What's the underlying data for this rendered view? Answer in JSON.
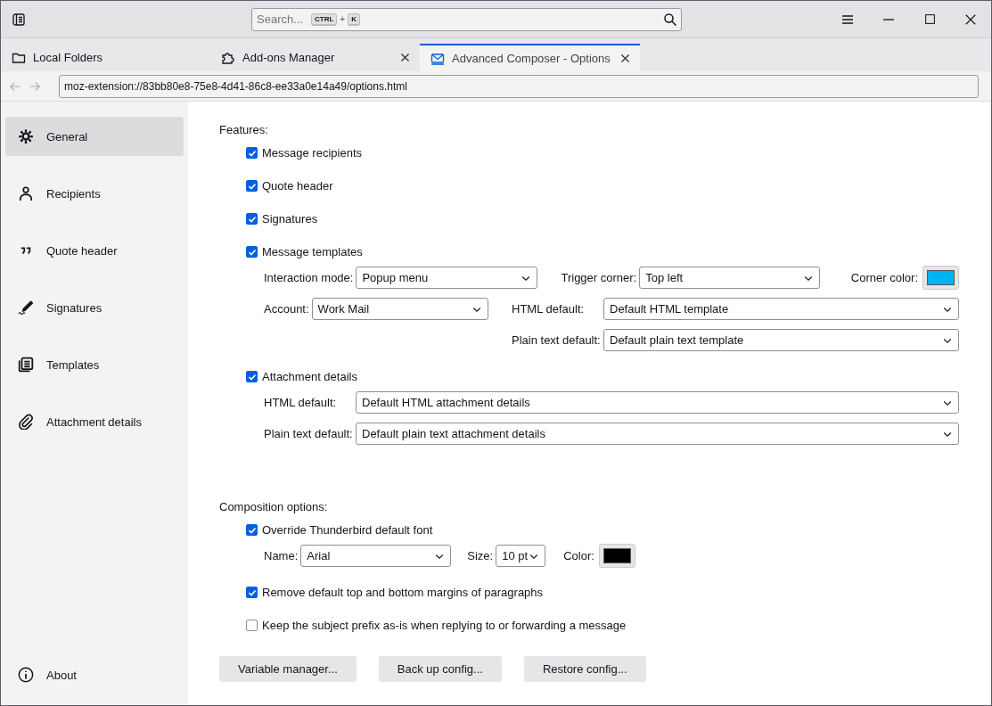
{
  "search": {
    "placeholder": "Search...",
    "shortcut": [
      "CTRL",
      "+",
      "K"
    ]
  },
  "tabs": [
    {
      "kind": "folder",
      "label": "Local Folders",
      "selected": false,
      "closable": false
    },
    {
      "kind": "puzzle",
      "label": "Add-ons Manager",
      "selected": false,
      "closable": true
    },
    {
      "kind": "envelope",
      "label": "Advanced Composer - Options",
      "selected": true,
      "closable": true
    }
  ],
  "url": "moz-extension://83bb80e8-75e8-4d41-86c8-ee33a0e14a49/options.html",
  "sidebar": {
    "items": [
      {
        "kind": "gear",
        "label": "General",
        "selected": true
      },
      {
        "kind": "person",
        "label": "Recipients",
        "selected": false
      },
      {
        "kind": "quote",
        "label": "Quote header",
        "selected": false
      },
      {
        "kind": "pen",
        "label": "Signatures",
        "selected": false
      },
      {
        "kind": "pages",
        "label": "Templates",
        "selected": false
      },
      {
        "kind": "clip",
        "label": "Attachment details",
        "selected": false
      }
    ],
    "about": {
      "label": "About"
    }
  },
  "features": {
    "heading": "Features:",
    "options": [
      {
        "kind": "plain",
        "label": "Message recipients",
        "checked": true
      },
      {
        "kind": "plain",
        "label": "Quote header",
        "checked": true
      },
      {
        "kind": "plain",
        "label": "Signatures",
        "checked": true
      },
      {
        "kind": "templates",
        "label": "Message templates",
        "checked": true,
        "interaction_mode": {
          "label": "Interaction mode:",
          "value": "Popup menu"
        },
        "trigger_corner": {
          "label": "Trigger corner:",
          "value": "Top left"
        },
        "corner_color": {
          "label": "Corner color:",
          "color": "#00b4f0"
        },
        "account": {
          "label": "Account:",
          "value": "Work Mail"
        },
        "html_default": {
          "label": "HTML default:",
          "value": "Default HTML template"
        },
        "plain_default": {
          "label": "Plain text default:",
          "value": "Default plain text template"
        }
      },
      {
        "kind": "attachments",
        "label": "Attachment details",
        "checked": true,
        "html_default": {
          "label": "HTML default:",
          "value": "Default HTML attachment details"
        },
        "plain_default": {
          "label": "Plain text default:",
          "value": "Default plain text attachment details"
        }
      }
    ]
  },
  "composition": {
    "heading": "Composition options:",
    "options": [
      {
        "kind": "font",
        "label": "Override Thunderbird default font",
        "checked": true,
        "name": {
          "label": "Name:",
          "value": "Arial"
        },
        "size": {
          "label": "Size:",
          "value": "10 pt"
        },
        "color": {
          "label": "Color:",
          "color": "#000000"
        }
      },
      {
        "kind": "plain",
        "label": "Remove default top and bottom margins of paragraphs",
        "checked": true
      },
      {
        "kind": "plain",
        "label": "Keep the subject prefix as-is when replying to or forwarding a message",
        "checked": false
      }
    ]
  },
  "buttons": [
    "Variable manager...",
    "Back up config...",
    "Restore config..."
  ]
}
